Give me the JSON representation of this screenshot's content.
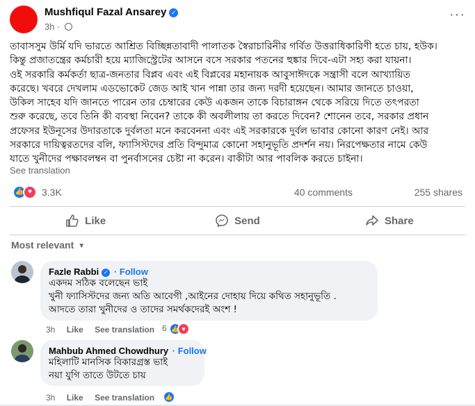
{
  "post": {
    "author": "Mushfiqul Fazal Ansarey",
    "time": "3h",
    "text_lines": [
      "তাবাসসুম উর্মি যদি ভারতে আশ্রিত বিচ্ছিন্নতাবাদী পালাতক স্বৈরাচারিনীর গর্বিত উত্তরাধিকারিণী হতে চায়, হউক।",
      "কিন্তু প্রজাতন্ত্রের কর্মচারী হয়ে ম্যাজিস্ট্রেটের আসনে বসে সরকার পতনের হুঙ্কার দিবে-এটা সহ্য করা যায়না।",
      "ওই সরকারি কর্মকর্তা ছাত্র-জনতার বিপ্লব এবং এই বিপ্লবের মহানায়ক আবুসাঈদকে সন্ত্রাসী বলে আখ্যায়িত",
      "করেছে। খবরে দেখলাম এডভোকেট জেড আই খান পান্না তার জন্য দরদী হয়েছেন। আমার জানতে চাওয়া,",
      "উকিল সাহেব যদি জানতে পারেন তার চেম্বারের কেউ একজন তাকে বিচারাঙ্গন থেকে সরিয়ে দিতে তৎপরতা",
      "শুরু করেছে, তবে তিনি কী ব্যবস্থা নিবেন? তাকে কী অবলীলায় তা করতে দিবেন? শোনেন তবে, সরকার প্রধান",
      "প্রফেসর ইউনূসের উদারতাকে দুর্বলতা মনে করবেননা এবং এই সরকারকে দুর্বল ভাবার কোনো কারণ নেই। আর",
      "সরকারে দায়িত্বরতদের বলি, ফ্যাসিস্টদের প্রতি বিন্দুমাত্র কোনো সহানুভূতি প্রদর্শন নয়। নিরপেক্ষতার নামে কেউ",
      "যাতে খুনীদের পক্ষাবলম্বন বা পুনর্বাসনের চেষ্টা না করেন। বাকীটা আর পাবলিক করতে চাইনা।"
    ],
    "see_translation": "See translation",
    "reaction_count": "3.3K",
    "comments_count": "40 comments",
    "shares_count": "255 shares"
  },
  "actions": {
    "like": "Like",
    "send": "Send",
    "share": "Share"
  },
  "sort_label": "Most relevant",
  "comments": [
    {
      "name": "Fazle Rabbi",
      "follow": "· Follow",
      "lines": [
        "একদম সঠিক বলেছেন ভাই",
        "খুনী ফ্যাসিস্টদের জন্য অতি আবেগী ,আইনের দোহায় দিয়ে কথিত সহানুভূতি .",
        "আদতে তারা খুনীদের ও তাদের সমর্থকদেরই অংশ !"
      ],
      "time": "3h",
      "like": "Like",
      "see_translation": "See translation",
      "reactions": "6"
    },
    {
      "name": "Mahbub Ahmed Chowdhury",
      "follow": "· Follow",
      "lines": [
        "মহিলাটি মানসিক বিকারগ্রস্ত ভাই",
        "নয়া যুগি তাতে উটতে চায়"
      ],
      "time": "3h",
      "like": "Like",
      "see_translation": "See translation",
      "reactions": ""
    }
  ],
  "colors": {
    "accent": "#1877f2",
    "avatar": "#f20d0d",
    "love": "#f33e58",
    "muted": "#65676b",
    "bubble": "#f0f2f5"
  }
}
